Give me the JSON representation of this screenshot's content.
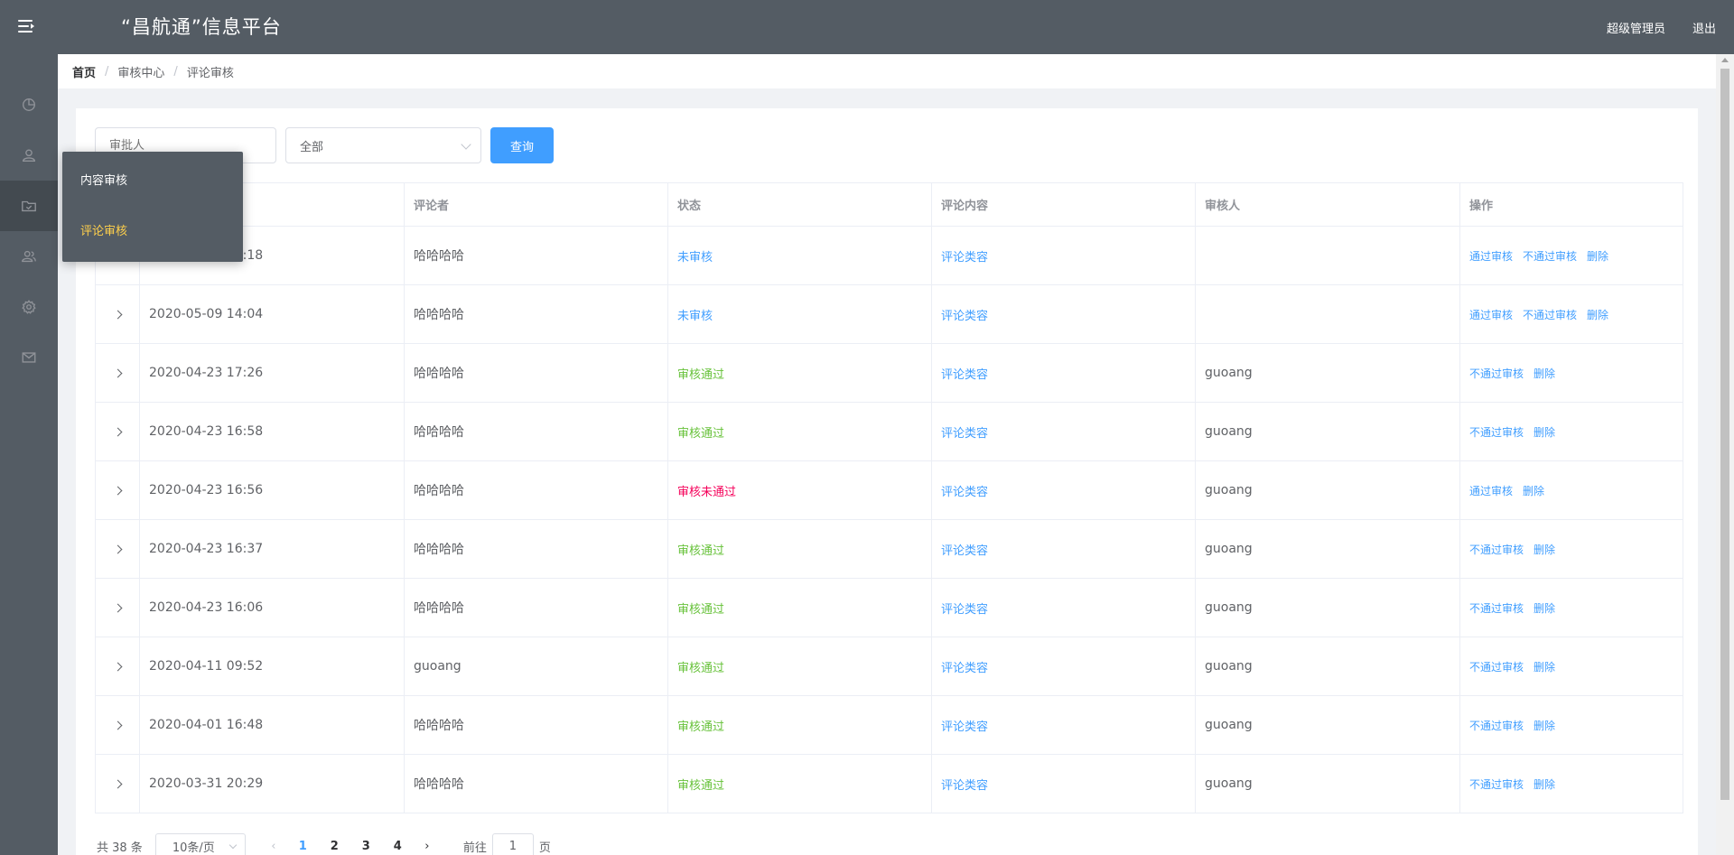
{
  "header": {
    "title": "“昌航通”信息平台",
    "user_role": "超级管理员",
    "logout": "退出"
  },
  "sidebar": {
    "icons": [
      "dashboard-icon",
      "user-icon",
      "folder-check-icon",
      "user-group-icon",
      "gear-icon",
      "mail-icon"
    ],
    "active_index": 2,
    "popup": {
      "items": [
        "内容审核",
        "评论审核"
      ],
      "active_index": 1
    }
  },
  "breadcrumb": {
    "home": "首页",
    "section": "审核中心",
    "current": "评论审核",
    "separator": "/"
  },
  "filter": {
    "approver_placeholder": "审批人",
    "status_selected": "全部",
    "query_label": "查询"
  },
  "table": {
    "columns": [
      "",
      "",
      "评论者",
      "状态",
      "评论内容",
      "审核人",
      "操作"
    ],
    "rows": [
      {
        "time": "2020-05-09 14:18",
        "commenter": "哈哈哈哈",
        "status": "未审核",
        "status_type": "pending",
        "content": "评论类容",
        "approver": "",
        "actions": [
          "通过审核",
          "不通过审核",
          "删除"
        ]
      },
      {
        "time": "2020-05-09 14:04",
        "commenter": "哈哈哈哈",
        "status": "未审核",
        "status_type": "pending",
        "content": "评论类容",
        "approver": "",
        "actions": [
          "通过审核",
          "不通过审核",
          "删除"
        ]
      },
      {
        "time": "2020-04-23 17:26",
        "commenter": "哈哈哈哈",
        "status": "审核通过",
        "status_type": "pass",
        "content": "评论类容",
        "approver": "guoang",
        "actions": [
          "不通过审核",
          "删除"
        ]
      },
      {
        "time": "2020-04-23 16:58",
        "commenter": "哈哈哈哈",
        "status": "审核通过",
        "status_type": "pass",
        "content": "评论类容",
        "approver": "guoang",
        "actions": [
          "不通过审核",
          "删除"
        ]
      },
      {
        "time": "2020-04-23 16:56",
        "commenter": "哈哈哈哈",
        "status": "审核未通过",
        "status_type": "fail",
        "content": "评论类容",
        "approver": "guoang",
        "actions": [
          "通过审核",
          "删除"
        ]
      },
      {
        "time": "2020-04-23 16:37",
        "commenter": "哈哈哈哈",
        "status": "审核通过",
        "status_type": "pass",
        "content": "评论类容",
        "approver": "guoang",
        "actions": [
          "不通过审核",
          "删除"
        ]
      },
      {
        "time": "2020-04-23 16:06",
        "commenter": "哈哈哈哈",
        "status": "审核通过",
        "status_type": "pass",
        "content": "评论类容",
        "approver": "guoang",
        "actions": [
          "不通过审核",
          "删除"
        ]
      },
      {
        "time": "2020-04-11 09:52",
        "commenter": "guoang",
        "status": "审核通过",
        "status_type": "pass",
        "content": "评论类容",
        "approver": "guoang",
        "actions": [
          "不通过审核",
          "删除"
        ]
      },
      {
        "time": "2020-04-01 16:48",
        "commenter": "哈哈哈哈",
        "status": "审核通过",
        "status_type": "pass",
        "content": "评论类容",
        "approver": "guoang",
        "actions": [
          "不通过审核",
          "删除"
        ]
      },
      {
        "time": "2020-03-31 20:29",
        "commenter": "哈哈哈哈",
        "status": "审核通过",
        "status_type": "pass",
        "content": "评论类容",
        "approver": "guoang",
        "actions": [
          "不通过审核",
          "删除"
        ]
      }
    ]
  },
  "pagination": {
    "total": "共 38 条",
    "page_size": "10条/页",
    "pages": [
      "1",
      "2",
      "3",
      "4"
    ],
    "current_page": "1",
    "goto_prefix": "前往",
    "goto_value": "1",
    "goto_suffix": "页"
  },
  "colors": {
    "header_bg": "#545c64",
    "primary": "#409eff",
    "success": "#67c23a",
    "danger": "#f5005a",
    "menu_active": "#ffd04b"
  }
}
